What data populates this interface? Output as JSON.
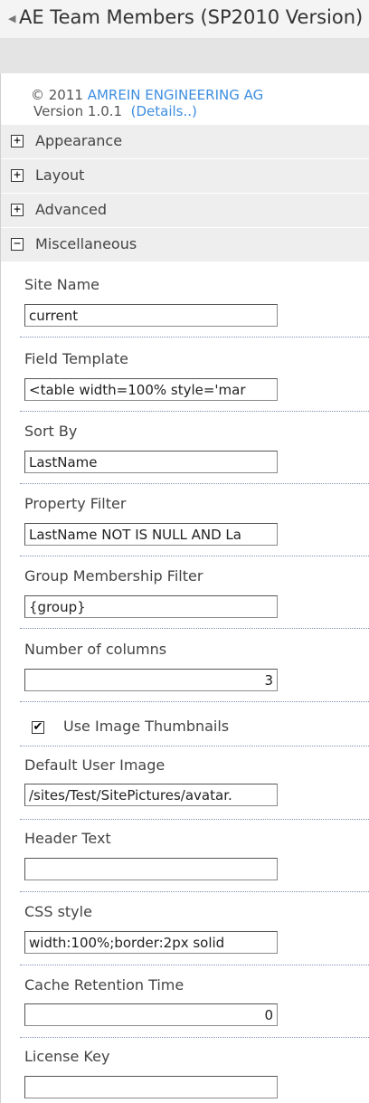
{
  "header": {
    "title": "AE Team Members (SP2010 Version)"
  },
  "info": {
    "copyright_prefix": "© 2011 ",
    "company": "AMREIN ENGINEERING AG",
    "version": "Version 1.0.1",
    "details_link": "(Details..)"
  },
  "sections": [
    {
      "label": "Appearance",
      "expander": "+"
    },
    {
      "label": "Layout",
      "expander": "+"
    },
    {
      "label": "Advanced",
      "expander": "+"
    },
    {
      "label": "Miscellaneous",
      "expander": "−"
    }
  ],
  "properties": {
    "site_name": {
      "label": "Site Name",
      "value": "current"
    },
    "field_template": {
      "label": "Field Template",
      "value": "<table width=100% style='mar"
    },
    "sort_by": {
      "label": "Sort By",
      "value": "LastName"
    },
    "property_filter": {
      "label": "Property Filter",
      "value": "LastName NOT IS NULL AND La"
    },
    "group_membership_filter": {
      "label": "Group Membership Filter",
      "value": "{group}"
    },
    "number_of_columns": {
      "label": "Number of columns",
      "value": "3"
    },
    "use_image_thumbnails": {
      "label": "Use Image Thumbnails",
      "checked": true,
      "mark": "✔"
    },
    "default_user_image": {
      "label": "Default User Image",
      "value": "/sites/Test/SitePictures/avatar."
    },
    "header_text": {
      "label": "Header Text",
      "value": ""
    },
    "css_style": {
      "label": "CSS style",
      "value": "width:100%;border:2px solid"
    },
    "cache_retention_time": {
      "label": "Cache Retention Time",
      "value": "0"
    },
    "license_key": {
      "label": "License Key",
      "value": ""
    }
  }
}
